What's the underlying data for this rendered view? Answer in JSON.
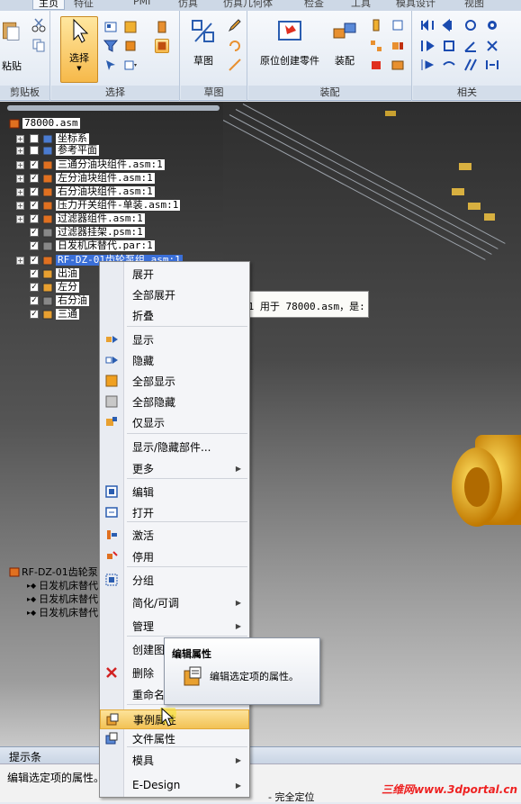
{
  "ribbon": {
    "tabs": [
      "主页",
      "特征",
      "PMI",
      "仿真",
      "仿真几何体",
      "检查",
      "工具",
      "模具设计",
      "视图"
    ],
    "groups": {
      "clipboard": {
        "label": "剪贴板",
        "paste": "粘贴"
      },
      "select": {
        "label": "选择",
        "select_button": "选择"
      },
      "sketch": {
        "label": "草图",
        "sketch_button": "草图"
      },
      "assemble": {
        "label": "装配",
        "place_part": "原位创建零件",
        "assemble_button": "装配"
      },
      "related": {
        "label": "相关"
      }
    }
  },
  "pathfinder": {
    "root": "78000.asm",
    "items": [
      {
        "label": "坐标系",
        "checked": false,
        "expander": "+"
      },
      {
        "label": "参考平面",
        "checked": false,
        "expander": "+"
      },
      {
        "label": "三通分油块组件.asm:1",
        "checked": true,
        "expander": "+"
      },
      {
        "label": "左分油块组件.asm:1",
        "checked": true,
        "expander": "+"
      },
      {
        "label": "右分油块组件.asm:1",
        "checked": true,
        "expander": "+"
      },
      {
        "label": "压力开关组件-单装.asm:1",
        "checked": true,
        "expander": "+"
      },
      {
        "label": "过滤器组件.asm:1",
        "checked": true,
        "expander": "+"
      },
      {
        "label": "过滤器挂架.psm:1",
        "checked": true,
        "expander": ""
      },
      {
        "label": "日发机床替代.par:1",
        "checked": true,
        "expander": ""
      },
      {
        "label": "RF-DZ-01齿轮泵组.asm:1",
        "checked": true,
        "expander": "+"
      },
      {
        "label": "出油",
        "checked": true,
        "expander": ""
      },
      {
        "label": "左分",
        "checked": true,
        "expander": ""
      },
      {
        "label": "右分油",
        "checked": true,
        "expander": ""
      },
      {
        "label": "三通",
        "checked": true,
        "expander": ""
      }
    ]
  },
  "tooltip_behind": ":1 用于 78000.asm，是:",
  "context_menu": {
    "items": [
      {
        "label": "展开",
        "icon": "none",
        "submenu": false
      },
      {
        "label": "全部展开",
        "icon": "none",
        "submenu": false
      },
      {
        "label": "折叠",
        "icon": "none",
        "submenu": false
      },
      {
        "label": "显示",
        "icon": "show-icon",
        "submenu": false
      },
      {
        "label": "隐藏",
        "icon": "hide-icon",
        "submenu": false
      },
      {
        "label": "全部显示",
        "icon": "show-all-icon",
        "submenu": false
      },
      {
        "label": "全部隐藏",
        "icon": "hide-all-icon",
        "submenu": false
      },
      {
        "label": "仅显示",
        "icon": "show-only-icon",
        "submenu": false
      },
      {
        "label": "显示/隐藏部件...",
        "icon": "none",
        "submenu": false
      },
      {
        "label": "更多",
        "icon": "none",
        "submenu": true
      },
      {
        "label": "编辑",
        "icon": "edit-icon",
        "submenu": false
      },
      {
        "label": "打开",
        "icon": "open-icon",
        "submenu": false
      },
      {
        "label": "激活",
        "icon": "activate-icon",
        "submenu": false
      },
      {
        "label": "停用",
        "icon": "deactivate-icon",
        "submenu": false
      },
      {
        "label": "分组",
        "icon": "group-icon",
        "submenu": false
      },
      {
        "label": "简化/可调",
        "icon": "none",
        "submenu": true
      },
      {
        "label": "管理",
        "icon": "none",
        "submenu": true
      },
      {
        "label": "创建图",
        "icon": "none",
        "submenu": false
      },
      {
        "label": "删除",
        "icon": "delete-icon",
        "submenu": false
      },
      {
        "label": "重命名",
        "icon": "none",
        "submenu": false
      },
      {
        "label": "事例属性",
        "icon": "occurrence-properties-icon",
        "submenu": false
      },
      {
        "label": "文件属性",
        "icon": "file-properties-icon",
        "submenu": false
      },
      {
        "label": "模具",
        "icon": "none",
        "submenu": true
      },
      {
        "label": "E-Design",
        "icon": "none",
        "submenu": true
      }
    ],
    "hovered": "事例属性"
  },
  "subtooltip": {
    "title": "编辑属性",
    "description": "编辑选定项的属性。"
  },
  "lower_panel": {
    "title": "RF-DZ-01齿轮泵",
    "items": [
      "日发机床替代",
      "日发机床替代",
      "日发机床替代"
    ]
  },
  "prompt_bar": {
    "title": "提示条",
    "text": "编辑选定项的属性。"
  },
  "status_bar": {
    "text": "- 完全定位"
  },
  "watermark": "三维网www.3dportal.cn",
  "colors": {
    "accent": "#3a6fd8",
    "hover": "#f2c255",
    "delete": "#d22222"
  }
}
